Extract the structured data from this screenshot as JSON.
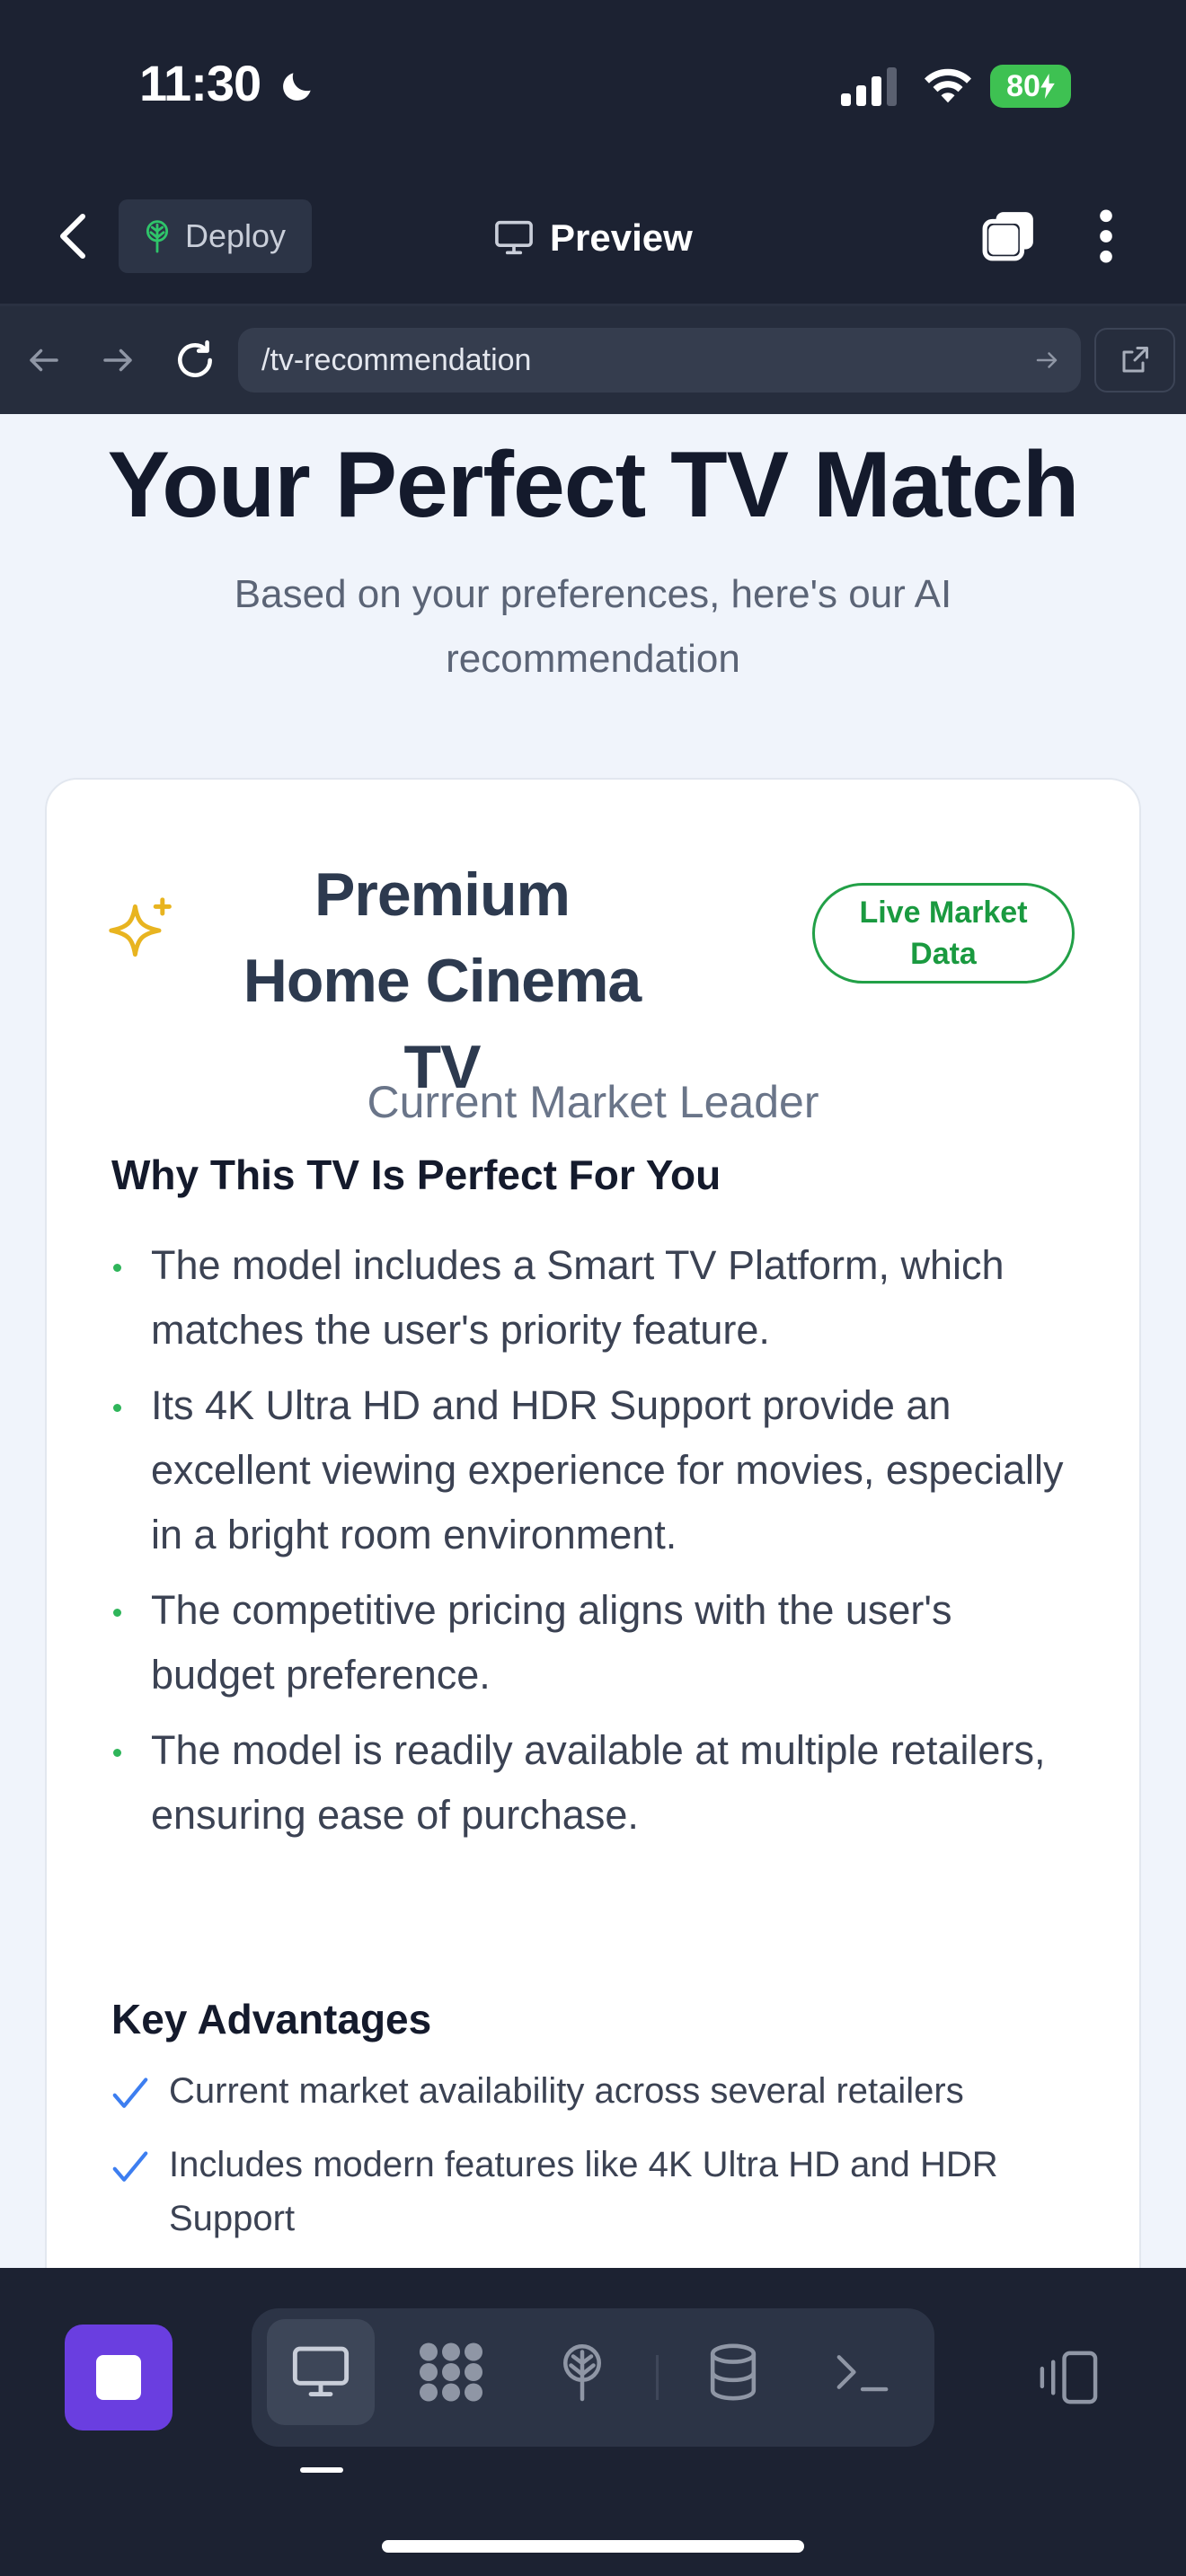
{
  "status_bar": {
    "time": "11:30",
    "battery": "80"
  },
  "top_bar": {
    "deploy_label": "Deploy",
    "preview_label": "Preview"
  },
  "address_bar": {
    "url": "/tv-recommendation"
  },
  "page": {
    "title": "Your Perfect TV Match",
    "subtitle": "Based on your preferences, here's our AI recommendation"
  },
  "card": {
    "title": "Premium Home Cinema TV",
    "badge": "Live Market Data",
    "subtitle": "Current Market Leader",
    "why_heading": "Why This TV Is Perfect For You",
    "why_items": [
      "The model includes a Smart TV Platform, which matches the user's priority feature.",
      "Its 4K Ultra HD and HDR Support provide an excellent viewing experience for movies, especially in a bright room environment.",
      "The competitive pricing aligns with the user's budget preference.",
      "The model is readily available at multiple retailers, ensuring ease of purchase."
    ],
    "advantages_heading": "Key Advantages",
    "advantages": [
      "Current market availability across several retailers",
      "Includes modern features like 4K Ultra HD and HDR Support"
    ]
  },
  "icons": {
    "back": "chevron-left-icon",
    "deploy": "globe-tree-icon",
    "preview": "monitor-icon",
    "tabs": "tabs-icon",
    "more": "more-vertical-icon",
    "nav_back": "arrow-left-icon",
    "nav_forward": "arrow-right-icon",
    "reload": "reload-icon",
    "go": "arrow-right-icon",
    "external": "external-link-icon",
    "sparkle": "sparkle-icon",
    "check": "check-icon"
  },
  "colors": {
    "accent": "#6a3ee0",
    "badge_green": "#22a047",
    "dark_bg": "#1c2232",
    "page_bg": "#f0f4fb"
  }
}
